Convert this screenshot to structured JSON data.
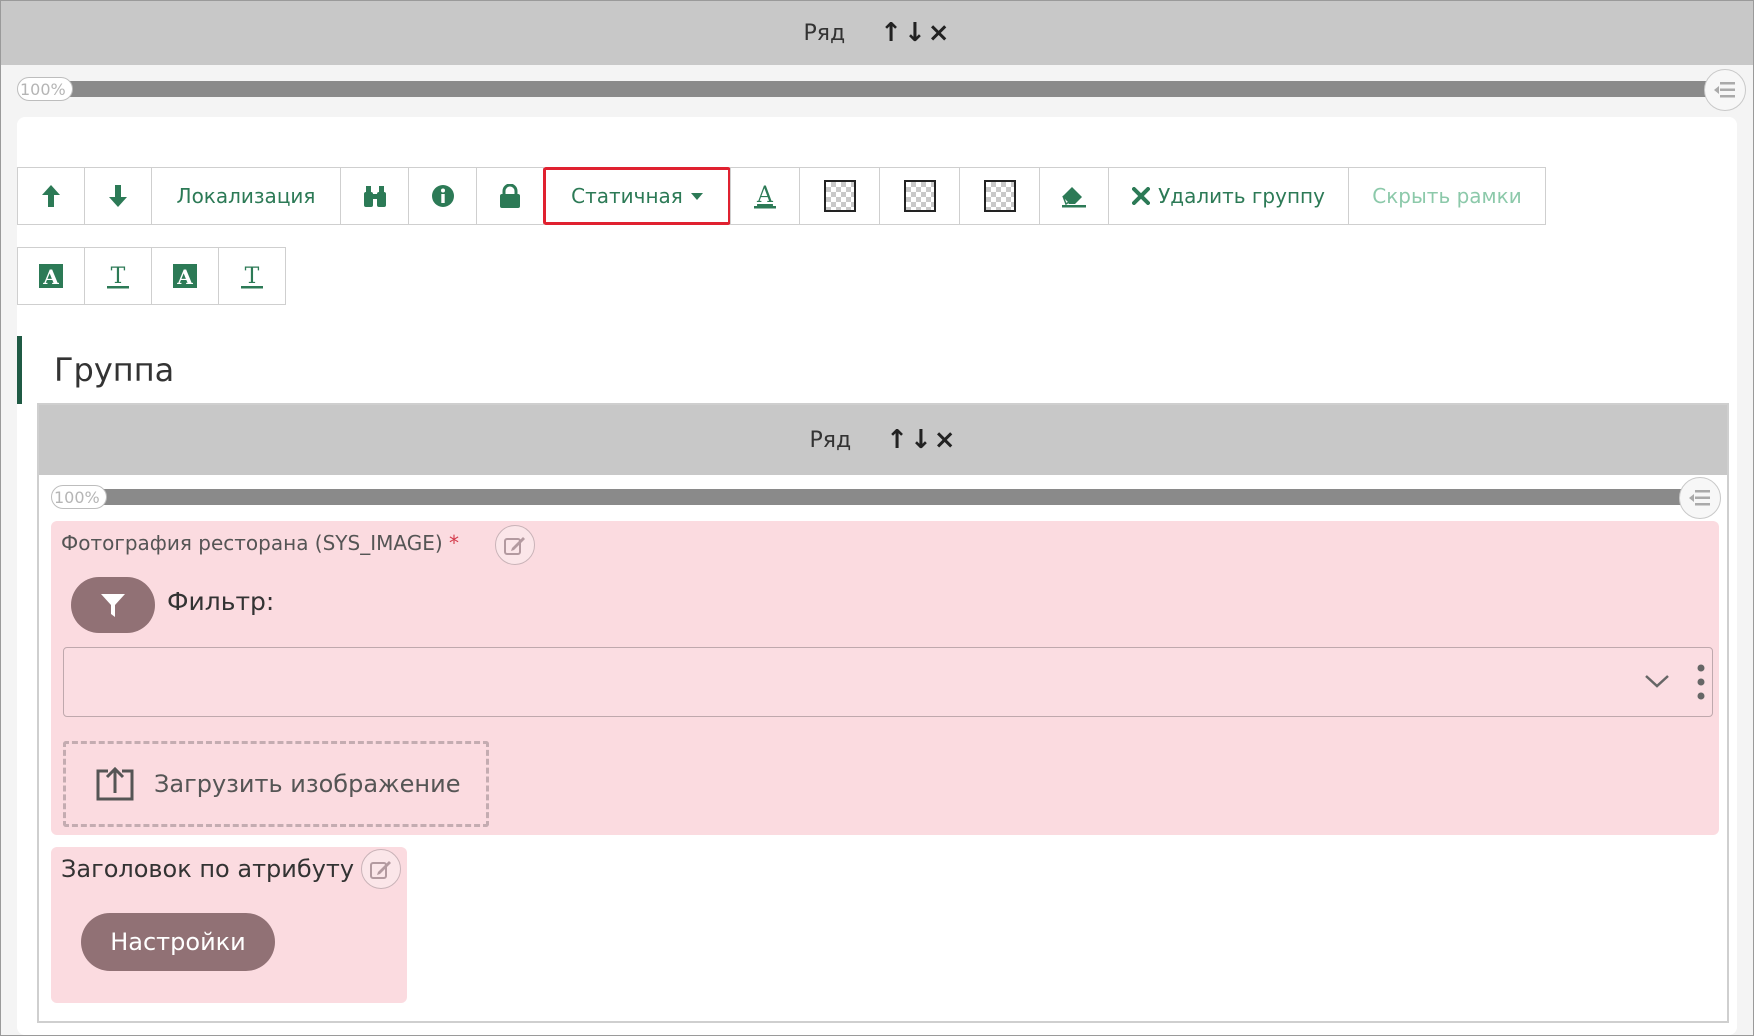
{
  "outer_row": {
    "label": "Ряд",
    "up_icon": "↑",
    "down_icon": "↓",
    "close_icon": "×",
    "width_percent": "100%"
  },
  "toolbar": {
    "localization_label": "Локализация",
    "static_label": "Статичная",
    "delete_group_label": "Удалить группу",
    "hide_borders_label": "Скрыть рамки",
    "text_a_glyph": "A",
    "text_t_glyph": "T"
  },
  "group": {
    "title": "Группа"
  },
  "inner_row": {
    "label": "Ряд",
    "up_icon": "↑",
    "down_icon": "↓",
    "close_icon": "×",
    "width_percent": "100%"
  },
  "image_field": {
    "label": "Фотография ресторана (SYS_IMAGE)",
    "required_mark": "*",
    "filter_label": "Фильтр:",
    "select_value": "",
    "upload_label": "Загрузить изображение"
  },
  "attribute_field": {
    "label": "Заголовок по атрибуту",
    "settings_label": "Настройки"
  },
  "colors": {
    "accent_green": "#2c7a56",
    "highlight_red": "#e02130",
    "pink_bg": "#fbdbe0",
    "mauve_button": "#917175"
  }
}
